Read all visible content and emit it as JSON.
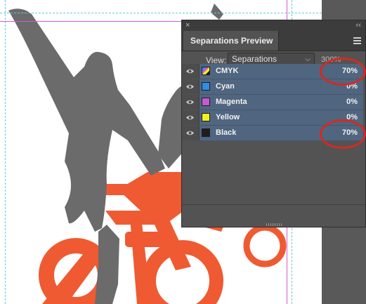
{
  "panel": {
    "close_glyph": "×",
    "collapse_glyph": "‹‹",
    "title": "Separations Preview",
    "view_label": "View:",
    "view_value": "Separations",
    "zoom_value": "300%"
  },
  "inks": [
    {
      "name": "CMYK",
      "percent": "70%",
      "swatch": "cmyk"
    },
    {
      "name": "Cyan",
      "percent": "0%",
      "swatch": "#2e8ee6"
    },
    {
      "name": "Magenta",
      "percent": "0%",
      "swatch": "#c45bd1"
    },
    {
      "name": "Yellow",
      "percent": "0%",
      "swatch": "#f5ef1d"
    },
    {
      "name": "Black",
      "percent": "70%",
      "swatch": "#1e1e1e"
    }
  ],
  "colors": {
    "figure_gray": "#6b6b6b",
    "bike_orange": "#ef5a32",
    "annotation_red": "#d42a22",
    "panel_bg": "#535353",
    "row_selected": "#50657f"
  }
}
